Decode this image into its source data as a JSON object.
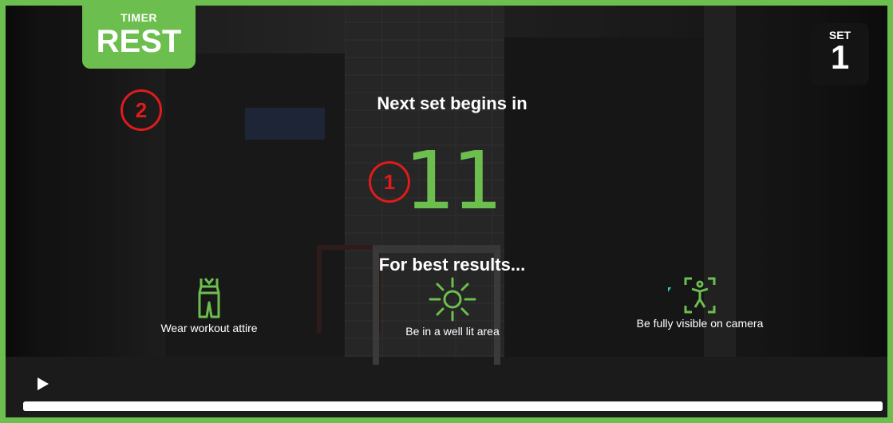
{
  "timer": {
    "label": "TIMER",
    "value": "REST"
  },
  "set": {
    "label": "SET",
    "value": "1"
  },
  "markers": {
    "one": "1",
    "two": "2"
  },
  "countdown": {
    "heading": "Next set begins in",
    "value": "11"
  },
  "tips": {
    "heading": "For best results...",
    "items": [
      {
        "icon": "workout-attire-icon",
        "label": "Wear workout attire"
      },
      {
        "icon": "sun-icon",
        "label": "Be in a well lit area"
      },
      {
        "icon": "full-body-camera-icon",
        "label": "Be fully visible on camera"
      }
    ]
  },
  "player": {
    "progress": 1.0
  },
  "colors": {
    "accent": "#6cbf4e",
    "marker": "#e01b1b",
    "badge_dark": "#141414"
  }
}
